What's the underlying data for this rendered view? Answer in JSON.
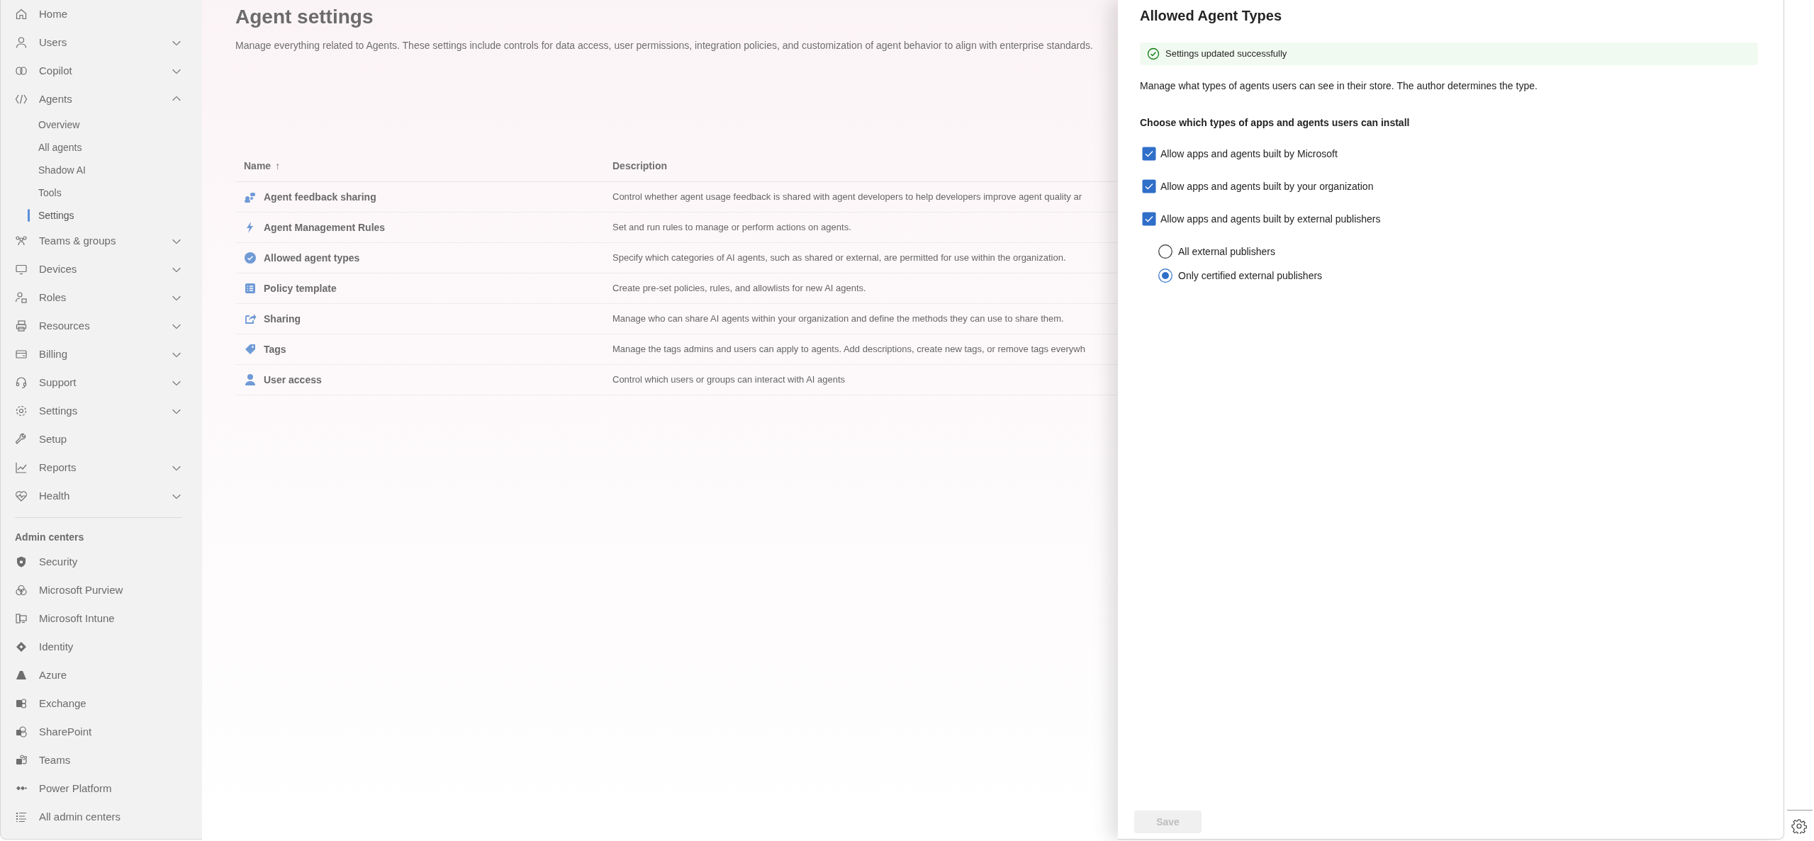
{
  "sidebar": {
    "items": [
      {
        "label": "Home",
        "kind": "link"
      },
      {
        "label": "Users",
        "kind": "group",
        "expanded": false
      },
      {
        "label": "Copilot",
        "kind": "group",
        "expanded": false
      },
      {
        "label": "Agents",
        "kind": "group",
        "expanded": true,
        "children": [
          {
            "label": "Overview",
            "selected": false
          },
          {
            "label": "All agents",
            "selected": false
          },
          {
            "label": "Shadow AI",
            "selected": false
          },
          {
            "label": "Tools",
            "selected": false
          },
          {
            "label": "Settings",
            "selected": true
          }
        ]
      },
      {
        "label": "Teams & groups",
        "kind": "group",
        "expanded": false
      },
      {
        "label": "Devices",
        "kind": "group",
        "expanded": false
      },
      {
        "label": "Roles",
        "kind": "group",
        "expanded": false
      },
      {
        "label": "Resources",
        "kind": "group",
        "expanded": false
      },
      {
        "label": "Billing",
        "kind": "group",
        "expanded": false
      },
      {
        "label": "Support",
        "kind": "group",
        "expanded": false
      },
      {
        "label": "Settings",
        "kind": "group",
        "expanded": false
      },
      {
        "label": "Setup",
        "kind": "link"
      },
      {
        "label": "Reports",
        "kind": "group",
        "expanded": false
      },
      {
        "label": "Health",
        "kind": "group",
        "expanded": false
      }
    ],
    "admin_centers": {
      "heading": "Admin centers",
      "items": [
        "Security",
        "Microsoft Purview",
        "Microsoft Intune",
        "Identity",
        "Azure",
        "Exchange",
        "SharePoint",
        "Teams",
        "Power Platform",
        "All admin centers"
      ]
    }
  },
  "page": {
    "title": "Agent settings",
    "description": "Manage everything related to Agents. These settings include controls for data access, user permissions, integration policies, and customization of agent behavior to align with enterprise standards."
  },
  "table": {
    "columns": [
      {
        "label": "Name",
        "sort_arrow": "↑"
      },
      {
        "label": "Description"
      }
    ],
    "rows": [
      {
        "name": "Agent feedback sharing",
        "description": "Control whether agent usage feedback is shared with agent developers to help developers improve agent quality ar"
      },
      {
        "name": "Agent Management Rules",
        "description": "Set and run rules to manage or perform actions on agents."
      },
      {
        "name": "Allowed agent types",
        "description": "Specify which categories of AI agents, such as shared or external, are permitted for use within the organization."
      },
      {
        "name": "Policy template",
        "description": "Create pre-set policies, rules, and allowlists for new AI agents."
      },
      {
        "name": "Sharing",
        "description": "Manage who can share AI agents within your organization and define the methods they can use to share them."
      },
      {
        "name": "Tags",
        "description": "Manage the tags admins and users can apply to agents. Add descriptions, create new tags, or remove tags everywh"
      },
      {
        "name": "User access",
        "description": "Control which users or groups can interact with AI agents"
      }
    ]
  },
  "panel": {
    "title": "Allowed Agent Types",
    "message": "Settings updated successfully",
    "description": "Manage what types of agents users can see in their store. The author determines the type.",
    "question": "Choose which types of apps and agents users can install",
    "checkboxes": [
      {
        "label": "Allow apps and agents built by Microsoft",
        "checked": true
      },
      {
        "label": "Allow apps and agents built by your organization",
        "checked": true
      },
      {
        "label": "Allow apps and agents built by external publishers",
        "checked": true
      }
    ],
    "radios": [
      {
        "label": "All external publishers",
        "selected": false
      },
      {
        "label": "Only certified external publishers",
        "selected": true
      }
    ],
    "save_button": {
      "label": "Save",
      "disabled": true
    }
  }
}
